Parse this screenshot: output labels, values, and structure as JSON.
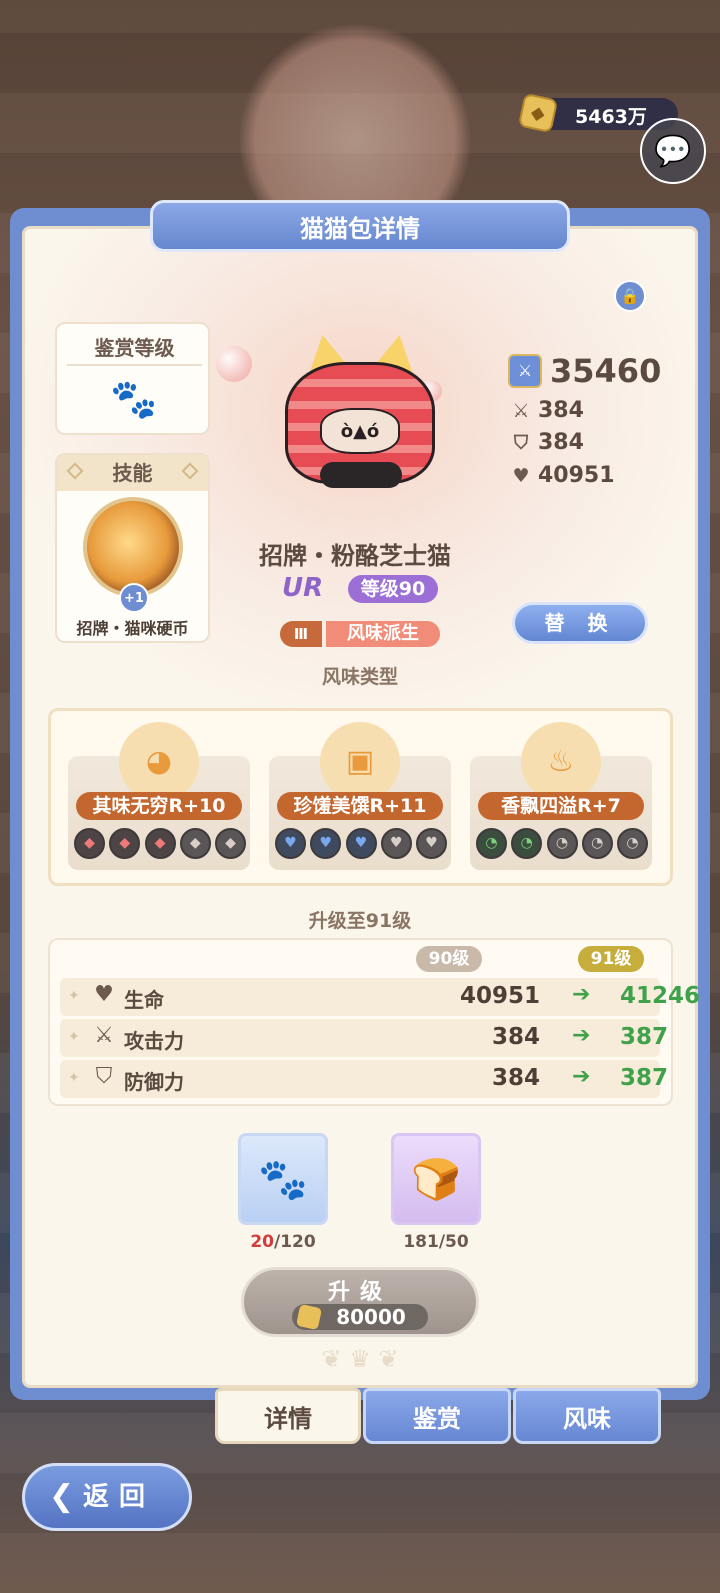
{
  "top": {
    "coins": "5463万"
  },
  "panel": {
    "title": "猫猫包详情"
  },
  "appreciation": {
    "title": "鉴赏等级"
  },
  "skill": {
    "title": "技能",
    "badge": "+1",
    "name": "招牌・猫咪硬币"
  },
  "stats": {
    "power": "35460",
    "attack": "384",
    "defense": "384",
    "hp": "40951"
  },
  "cat": {
    "name": "招牌・粉酪芝士猫",
    "rarity": "UR",
    "level": "等级90",
    "rank": "Ⅲ",
    "tag": "风味派生"
  },
  "replace_label": "替 换",
  "flavor_section": {
    "title": "风味类型",
    "items": [
      {
        "label": "其味无穷R+10",
        "icon": "cat-face-icon",
        "gem_color": "#f07a7a",
        "gems": [
          "◆",
          "◆",
          "◆",
          "◆",
          "◆"
        ]
      },
      {
        "label": "珍馐美馔R+11",
        "icon": "dish-icon",
        "gem_color": "#7aa8ef",
        "gems": [
          "♥",
          "♥",
          "♥",
          "♥",
          "♥"
        ]
      },
      {
        "label": "香飘四溢R+7",
        "icon": "aroma-icon",
        "gem_color": "#7ed07a",
        "gems": [
          "◔",
          "◔",
          "◔",
          "◔",
          "◔"
        ]
      }
    ]
  },
  "upgrade": {
    "title": "升级至91级",
    "cur_level": "90级",
    "next_level": "91级",
    "rows": [
      {
        "label": "生命",
        "icon": "heart-icon",
        "cur": "40951",
        "next": "41246"
      },
      {
        "label": "攻击力",
        "icon": "swords-icon",
        "cur": "384",
        "next": "387"
      },
      {
        "label": "防御力",
        "icon": "shield-icon",
        "cur": "384",
        "next": "387"
      }
    ],
    "materials": [
      {
        "have": "20",
        "need": "/120",
        "icon": "paw-candy-icon"
      },
      {
        "have": "181",
        "need": "/50",
        "icon": "paw-toast-icon"
      }
    ],
    "button_label": "升级",
    "cost": "80000"
  },
  "tabs": [
    "详情",
    "鉴赏",
    "风味"
  ],
  "back_label": "返回"
}
